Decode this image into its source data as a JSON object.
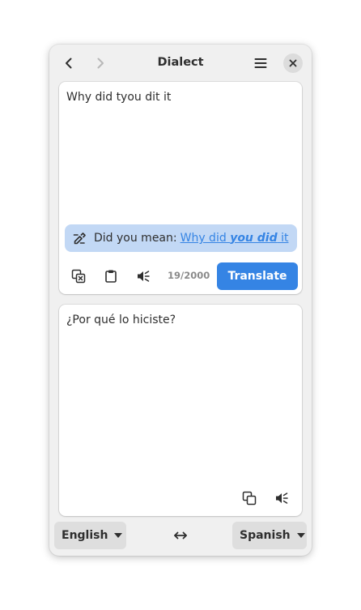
{
  "window": {
    "title": "Dialect"
  },
  "header": {
    "back_icon": "go-previous-icon",
    "forward_icon": "go-next-icon",
    "menu_icon": "open-menu-icon",
    "close_icon": "window-close-icon"
  },
  "source": {
    "text": "Why did tyou dit it",
    "suggestion": {
      "label": "Did you mean:",
      "link_prefix": "Why did ",
      "link_bold": "you did",
      "link_suffix": " it"
    },
    "char_count": "19/2000",
    "translate_label": "Translate"
  },
  "destination": {
    "text": "¿Por qué lo hiciste?"
  },
  "languages": {
    "source": "English",
    "target": "Spanish",
    "swap_icon": "swap-horizontal-icon"
  },
  "colors": {
    "accent": "#3584e4",
    "suggestion_bg": "#c2d8f5",
    "window_bg": "#f0f0f0"
  }
}
